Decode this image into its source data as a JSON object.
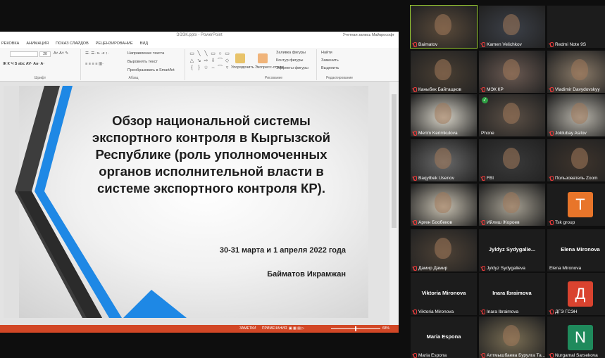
{
  "ppt": {
    "title": "ЭЭЭК.pptx - PowerPoint",
    "account": "Учетная запись Майкрософт",
    "tabs": [
      "РЕКОВКА",
      "АНИМАЦИЯ",
      "ПОКАЗ СЛАЙДОВ",
      "РЕЦЕНЗИРОВАНИЕ",
      "ВИД"
    ],
    "font_size": "20",
    "ribbon_groups": [
      "Шрифт",
      "Абзац",
      "Рисование",
      "Редактирование"
    ],
    "ribbon_items": {
      "text_direction": "Направление текста",
      "align_text": "Выровнять текст",
      "smartart": "Преобразовать в SmartArt",
      "arrange": "Упорядочить",
      "quick_styles": "Экспресс-стили",
      "shape_fill": "Заливка фигуры",
      "shape_outline": "Контур фигуры",
      "shape_effects": "Эффекты фигуры",
      "find": "Найти",
      "replace": "Заменить",
      "select": "Выделить"
    },
    "slide": {
      "title": "Обзор национальной системы экспортного контроля в Кыргызской Республике (роль уполномоченных органов исполнительной власти в системе экспортного контроля КР).",
      "date": "30-31 марта и 1 апреля 2022 года",
      "author": "Байматов Икрамжан"
    },
    "status": {
      "notes": "ЗАМЕТКИ",
      "comments": "ПРИМЕЧАНИЯ",
      "zoom": "68%"
    }
  },
  "participants": [
    {
      "name": "Baimatov",
      "muted": true,
      "video": true,
      "active": true,
      "hue": "#5a4a3a"
    },
    {
      "name": "Kamen Velichkov",
      "muted": true,
      "video": true,
      "active": false,
      "hue": "#3c4048"
    },
    {
      "name": "Redmi Note 9S",
      "muted": true,
      "video": false,
      "active": false,
      "hue": "#1a1a1a"
    },
    {
      "name": "Каныбек Байтащков",
      "muted": true,
      "video": true,
      "active": false,
      "hue": "#4a3f33"
    },
    {
      "name": "МЭК КР",
      "muted": true,
      "video": true,
      "active": false,
      "hue": "#6b5a52"
    },
    {
      "name": "Vladimir Davydovskyy",
      "muted": true,
      "video": true,
      "active": false,
      "hue": "#8a7a68"
    },
    {
      "name": "Merim Kerimkulova",
      "muted": true,
      "video": true,
      "active": false,
      "hue": "#d8d4c8"
    },
    {
      "name": "Phone",
      "muted": false,
      "video": true,
      "active": false,
      "hue": "#5c5046",
      "verified": true
    },
    {
      "name": "Joldubay Asilov",
      "muted": true,
      "video": true,
      "active": false,
      "hue": "#b8b4aa"
    },
    {
      "name": "Baqytbek Usenov",
      "muted": true,
      "video": true,
      "active": false,
      "hue": "#6a6a6a"
    },
    {
      "name": "FBI",
      "muted": true,
      "video": true,
      "active": false,
      "hue": "#3a3a3a"
    },
    {
      "name": "Пользователь Zoom",
      "muted": true,
      "video": true,
      "active": false,
      "hue": "#3e342c"
    },
    {
      "name": "Арген Бообеков",
      "muted": true,
      "video": true,
      "active": false,
      "hue": "#c9c2b2"
    },
    {
      "name": "Ийлиш Жороев",
      "muted": true,
      "video": true,
      "active": false,
      "hue": "#a8a294"
    },
    {
      "name": "Tsk group",
      "muted": true,
      "video": false,
      "active": false,
      "letter": "T",
      "color": "#e8752a"
    },
    {
      "name": "Дамир Дамир",
      "muted": true,
      "video": true,
      "active": false,
      "hue": "#4e4236"
    },
    {
      "name": "Jyldyz Sydygalieva",
      "display": "Jyldyz Sydygalie...",
      "muted": true,
      "video": false,
      "active": false
    },
    {
      "name": "Elena Mironova",
      "display": "Elena Mironova",
      "muted": false,
      "video": false,
      "active": false
    },
    {
      "name": "Viktoria Mironova",
      "display": "Viktoria Mironova",
      "muted": true,
      "video": false,
      "active": false
    },
    {
      "name": "Inara Ibraimova",
      "display": "Inara Ibraimova",
      "muted": true,
      "video": false,
      "active": false
    },
    {
      "name": "ДГЭ ГСЭН",
      "muted": true,
      "video": false,
      "active": false,
      "letter": "Д",
      "color": "#d9432f"
    },
    {
      "name": "Maria Espona",
      "display": "Maria Espona",
      "muted": true,
      "video": false,
      "active": false
    },
    {
      "name": "Алтмышбаева Бурулга Та...",
      "muted": true,
      "video": true,
      "active": false,
      "hue": "#7a6e54"
    },
    {
      "name": "Nurgamal Sarsekova",
      "muted": true,
      "video": false,
      "active": false,
      "letter": "N",
      "color": "#1f8a5c"
    }
  ]
}
